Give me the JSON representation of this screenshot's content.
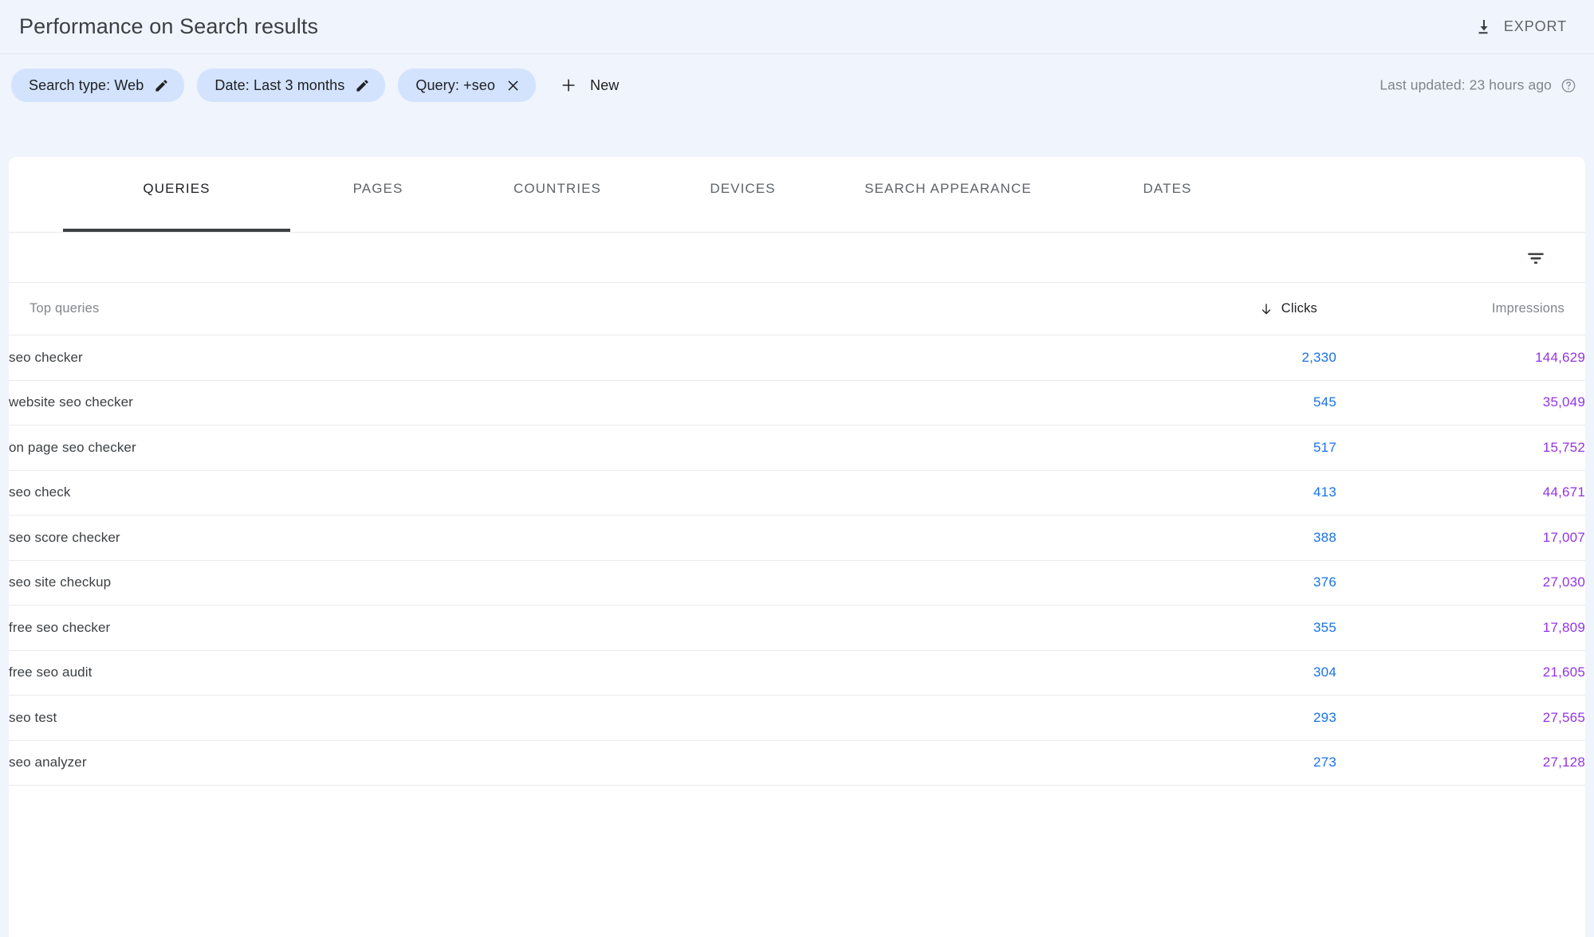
{
  "header": {
    "title": "Performance on Search results",
    "export_label": "EXPORT",
    "export_icon": "download-icon"
  },
  "filters": {
    "chips": [
      {
        "label": "Search type: Web",
        "icon": "pencil-icon",
        "action": "edit"
      },
      {
        "label": "Date: Last 3 months",
        "icon": "pencil-icon",
        "action": "edit"
      },
      {
        "label": "Query: +seo",
        "icon": "close-icon",
        "action": "remove"
      }
    ],
    "new_label": "New",
    "new_icon": "plus-icon",
    "last_updated": "Last updated: 23 hours ago",
    "help_icon": "help-circle-icon",
    "chip_color": "#d3e3fd"
  },
  "tabs": [
    {
      "label": "QUERIES",
      "active": true
    },
    {
      "label": "PAGES",
      "active": false
    },
    {
      "label": "COUNTRIES",
      "active": false
    },
    {
      "label": "DEVICES",
      "active": false
    },
    {
      "label": "SEARCH APPEARANCE",
      "active": false
    },
    {
      "label": "DATES",
      "active": false
    }
  ],
  "toolbar": {
    "filter_icon": "filter-list-icon"
  },
  "table": {
    "columns": {
      "query": "Top queries",
      "clicks": "Clicks",
      "impressions": "Impressions"
    },
    "sort": {
      "column": "Clicks",
      "direction": "descending",
      "icon": "arrow-down-icon"
    },
    "colors": {
      "clicks": "#1a73e8",
      "impressions": "#9334e6"
    },
    "rows": [
      {
        "query": "seo checker",
        "clicks": "2,330",
        "impressions": "144,629"
      },
      {
        "query": "website seo checker",
        "clicks": "545",
        "impressions": "35,049"
      },
      {
        "query": "on page seo checker",
        "clicks": "517",
        "impressions": "15,752"
      },
      {
        "query": "seo check",
        "clicks": "413",
        "impressions": "44,671"
      },
      {
        "query": "seo score checker",
        "clicks": "388",
        "impressions": "17,007"
      },
      {
        "query": "seo site checkup",
        "clicks": "376",
        "impressions": "27,030"
      },
      {
        "query": "free seo checker",
        "clicks": "355",
        "impressions": "17,809"
      },
      {
        "query": "free seo audit",
        "clicks": "304",
        "impressions": "21,605"
      },
      {
        "query": "seo test",
        "clicks": "293",
        "impressions": "27,565"
      },
      {
        "query": "seo analyzer",
        "clicks": "273",
        "impressions": "27,128"
      }
    ]
  }
}
